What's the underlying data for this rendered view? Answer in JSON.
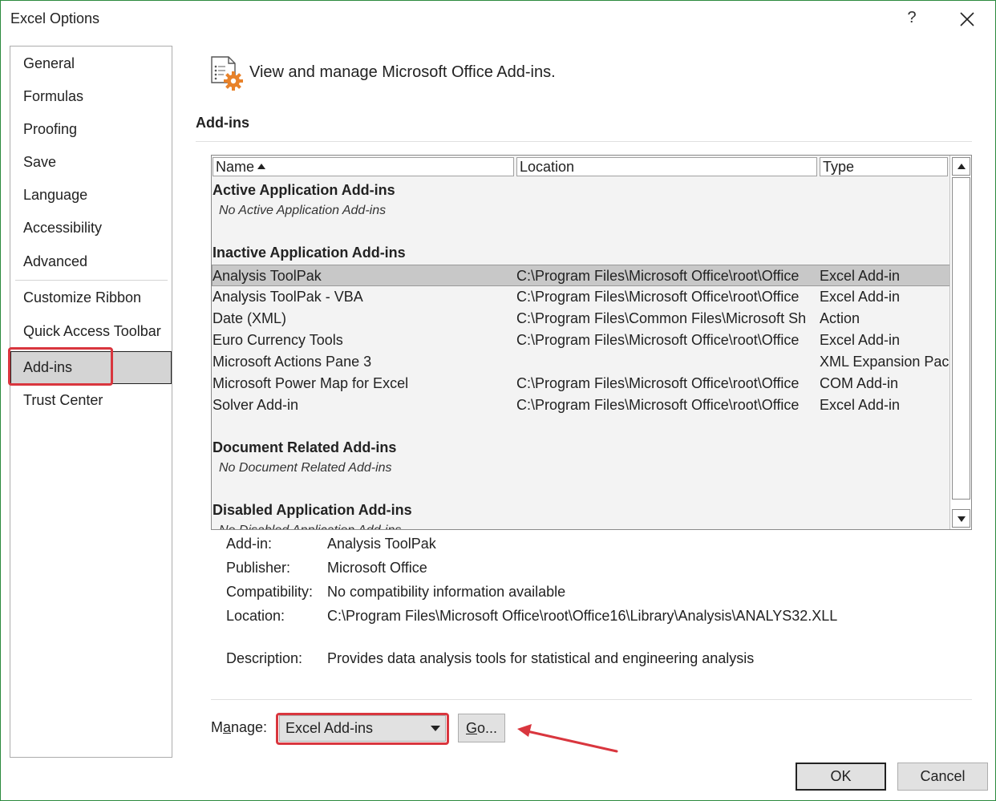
{
  "window": {
    "title": "Excel Options",
    "help_glyph": "?"
  },
  "sidebar": {
    "items": [
      {
        "label": "General"
      },
      {
        "label": "Formulas"
      },
      {
        "label": "Proofing"
      },
      {
        "label": "Save"
      },
      {
        "label": "Language"
      },
      {
        "label": "Accessibility"
      },
      {
        "label": "Advanced"
      },
      {
        "label": "Customize Ribbon"
      },
      {
        "label": "Quick Access Toolbar"
      },
      {
        "label": "Add-ins"
      },
      {
        "label": "Trust Center"
      }
    ],
    "selected": "Add-ins"
  },
  "main": {
    "header": "View and manage Microsoft Office Add-ins.",
    "section_title": "Add-ins",
    "columns": {
      "name": "Name",
      "location": "Location",
      "type": "Type"
    },
    "groups": {
      "active": {
        "title": "Active Application Add-ins",
        "empty": "No Active Application Add-ins"
      },
      "inactive": {
        "title": "Inactive Application Add-ins",
        "rows": [
          {
            "name": "Analysis ToolPak",
            "location": "C:\\Program Files\\Microsoft Office\\root\\Office",
            "type": "Excel Add-in"
          },
          {
            "name": "Analysis ToolPak - VBA",
            "location": "C:\\Program Files\\Microsoft Office\\root\\Office",
            "type": "Excel Add-in"
          },
          {
            "name": "Date (XML)",
            "location": "C:\\Program Files\\Common Files\\Microsoft Sh",
            "type": "Action"
          },
          {
            "name": "Euro Currency Tools",
            "location": "C:\\Program Files\\Microsoft Office\\root\\Office",
            "type": "Excel Add-in"
          },
          {
            "name": "Microsoft Actions Pane 3",
            "location": "",
            "type": "XML Expansion Pack"
          },
          {
            "name": "Microsoft Power Map for Excel",
            "location": "C:\\Program Files\\Microsoft Office\\root\\Office",
            "type": "COM Add-in"
          },
          {
            "name": "Solver Add-in",
            "location": "C:\\Program Files\\Microsoft Office\\root\\Office",
            "type": "Excel Add-in"
          }
        ]
      },
      "document": {
        "title": "Document Related Add-ins",
        "empty": "No Document Related Add-ins"
      },
      "disabled": {
        "title": "Disabled Application Add-ins",
        "empty": "No Disabled Application Add-ins"
      }
    },
    "details": {
      "addin_label": "Add-in:",
      "addin_value": "Analysis ToolPak",
      "publisher_label": "Publisher:",
      "publisher_value": "Microsoft Office",
      "compat_label": "Compatibility:",
      "compat_value": "No compatibility information available",
      "location_label": "Location:",
      "location_value": "C:\\Program Files\\Microsoft Office\\root\\Office16\\Library\\Analysis\\ANALYS32.XLL",
      "description_label": "Description:",
      "description_value": "Provides data analysis tools for statistical and engineering analysis"
    },
    "manage": {
      "label_pre": "M",
      "label_u": "a",
      "label_post": "nage:",
      "selected": "Excel Add-ins",
      "go_u": "G",
      "go_post": "o..."
    }
  },
  "footer": {
    "ok": "OK",
    "cancel": "Cancel"
  },
  "colors": {
    "highlight_red": "#d9363e",
    "selection_gray": "#c8c8c8",
    "icon_orange": "#e8822a"
  }
}
